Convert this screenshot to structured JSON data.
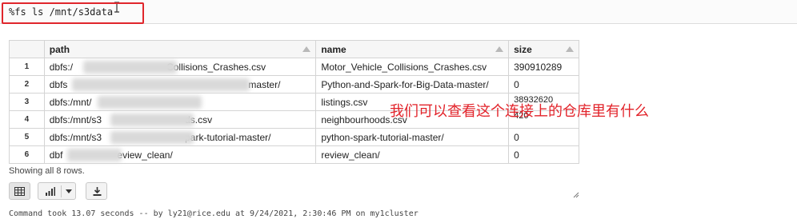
{
  "command": {
    "text": "%fs ls /mnt/s3data"
  },
  "table": {
    "columns": [
      {
        "label": "path"
      },
      {
        "label": "name"
      },
      {
        "label": "size"
      }
    ],
    "rows": [
      {
        "index": "1",
        "path_prefix": "dbfs:/",
        "path_suffix": "Collisions_Crashes.csv",
        "name": "Motor_Vehicle_Collisions_Crashes.csv",
        "size": "390910289"
      },
      {
        "index": "2",
        "path_prefix": "dbfs",
        "path_suffix": "master/",
        "name": "Python-and-Spark-for-Big-Data-master/",
        "size": "0"
      },
      {
        "index": "3",
        "path_prefix": "dbfs:/mnt/",
        "path_suffix": "",
        "name": "listings.csv",
        "size": "38932620"
      },
      {
        "index": "4",
        "path_prefix": "dbfs:/mnt/s3",
        "path_suffix": "ds.csv",
        "name": "neighbourhoods.csv",
        "size": "420"
      },
      {
        "index": "5",
        "path_prefix": "dbfs:/mnt/s3",
        "path_suffix": "park-tutorial-master/",
        "name": "python-spark-tutorial-master/",
        "size": "0"
      },
      {
        "index": "6",
        "path_prefix": "dbf",
        "path_suffix": "eview_clean/",
        "name": "review_clean/",
        "size": "0"
      }
    ]
  },
  "annotation": "我们可以查看这个连接上的仓库里有什么",
  "rows_note": "Showing all 8 rows.",
  "status": "Command took 13.07 seconds -- by ly21@rice.edu at 9/24/2021, 2:30:46 PM on my1cluster",
  "colors": {
    "highlight": "#e0262c",
    "annotation": "#e2232a"
  }
}
